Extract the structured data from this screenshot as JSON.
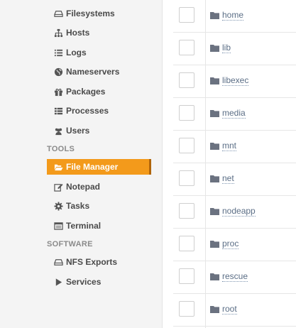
{
  "sidebar": {
    "items": [
      {
        "label": "Filesystems",
        "icon": "hdd-icon"
      },
      {
        "label": "Hosts",
        "icon": "sitemap-icon"
      },
      {
        "label": "Logs",
        "icon": "list-icon"
      },
      {
        "label": "Nameservers",
        "icon": "globe-icon"
      },
      {
        "label": "Packages",
        "icon": "gift-icon"
      },
      {
        "label": "Processes",
        "icon": "table-list-icon"
      },
      {
        "label": "Users",
        "icon": "users-icon"
      }
    ],
    "tools_header": "TOOLS",
    "tools": [
      {
        "label": "File Manager",
        "icon": "folder-open-icon",
        "active": true
      },
      {
        "label": "Notepad",
        "icon": "edit-icon"
      },
      {
        "label": "Tasks",
        "icon": "cog-icon"
      },
      {
        "label": "Terminal",
        "icon": "terminal-icon"
      }
    ],
    "software_header": "SOFTWARE",
    "software": [
      {
        "label": "NFS Exports",
        "icon": "hdd-icon"
      },
      {
        "label": "Services",
        "icon": "play-icon"
      }
    ]
  },
  "files": [
    {
      "name": "home"
    },
    {
      "name": "lib"
    },
    {
      "name": "libexec"
    },
    {
      "name": "media"
    },
    {
      "name": "mnt"
    },
    {
      "name": "net"
    },
    {
      "name": "nodeapp"
    },
    {
      "name": "proc"
    },
    {
      "name": "rescue"
    },
    {
      "name": "root"
    }
  ],
  "colors": {
    "accent": "#f39a1b",
    "link": "#5b6e86"
  }
}
